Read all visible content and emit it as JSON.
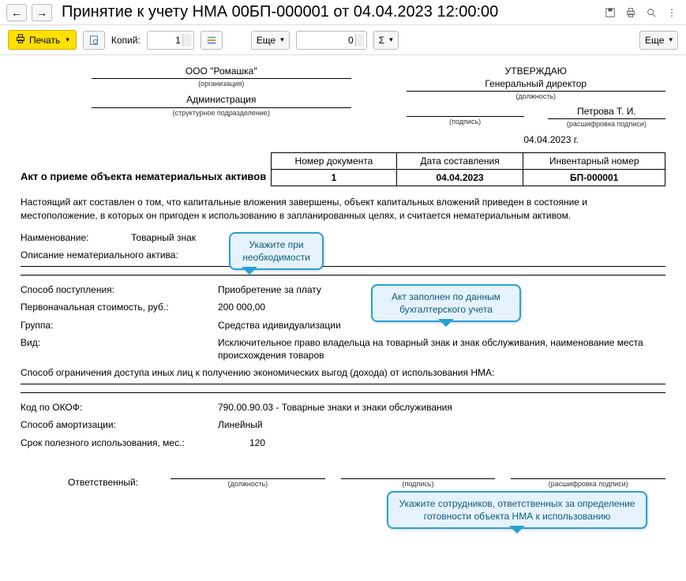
{
  "header": {
    "title": "Принятие к учету НМА 00БП-000001 от 04.04.2023 12:00:00"
  },
  "toolbar": {
    "print_label": "Печать",
    "copies_label": "Копий:",
    "copies_value": "1",
    "more1_label": "Еще",
    "sum_value": "0",
    "more2_label": "Еще"
  },
  "doc": {
    "org": "ООО \"Ромашка\"",
    "org_caption": "(организация)",
    "dept": "Администрация",
    "dept_caption": "(структурное подразделение)",
    "approve": "УТВЕРЖДАЮ",
    "position": "Генеральный директор",
    "position_caption": "(должность)",
    "sign_caption": "(подпись)",
    "signer": "Петрова Т. И.",
    "signer_caption": "(расшифровка подписи)",
    "date": "04.04.2023 г.",
    "act_title": "Акт о приеме объекта нематериальных активов",
    "table": {
      "h1": "Номер документа",
      "h2": "Дата составления",
      "h3": "Инвентарный номер",
      "v1": "1",
      "v2": "04.04.2023",
      "v3": "БП-000001"
    },
    "para1": "Настоящий акт составлен о том, что капитальные вложения завершены, объект капитальных вложений приведен в состояние и местоположение, в которых он пригоден к использованию в запланированных целях, и считается нематериальным активом.",
    "name_label": "Наименование:",
    "name_value": "Товарный знак",
    "desc_label": "Описание нематериального актива:",
    "method_label": "Способ поступления:",
    "method_value": "Приобретение за плату",
    "cost_label": "Первоначальная стоимость, руб.:",
    "cost_value": "200 000,00",
    "group_label": "Группа:",
    "group_value": "Средства идивидуализации",
    "kind_label": "Вид:",
    "kind_value": "Исключительное право владельца на товарный знак и знак обслуживания, наименование места происхождения товаров",
    "restrict": "Способ ограничения доступа иных лиц к получению экономических выгод (дохода) от использования НМА:",
    "okof_label": "Код по ОКОФ:",
    "okof_value": "790.00.90.03 - Товарные знаки и знаки обслуживания",
    "amort_label": "Способ амортизации:",
    "amort_value": "Линейный",
    "life_label": "Срок полезного использования, мес.:",
    "life_value": "120",
    "resp_label": "Ответственный:",
    "resp_c1": "(должность)",
    "resp_c2": "(подпись)",
    "resp_c3": "(расшифровка подписи)"
  },
  "callouts": {
    "c1": "Укажите при необходимости",
    "c2": "Акт заполнен по данным бухгалтерского учета",
    "c3": "Укажите сотрудников, ответственных за определение готовности объекта НМА к использованию"
  }
}
